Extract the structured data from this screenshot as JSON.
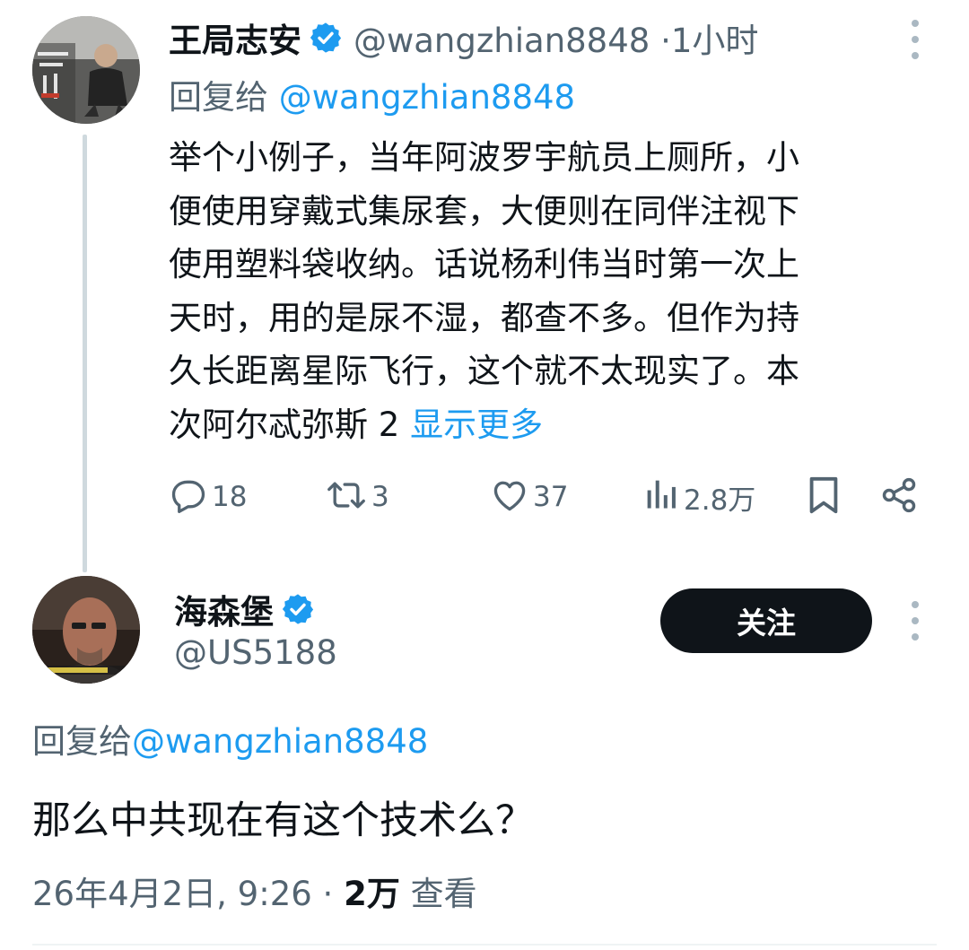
{
  "parent_tweet": {
    "display_name": "王局志安",
    "handle": "@wangzhian8848",
    "separator": "·",
    "time": "1小时",
    "reply_label": "回复给",
    "reply_mention": "@wangzhian8848",
    "body_lines": [
      "举个小例子，当年阿波罗宇航员上厕所，小",
      "便使用穿戴式集尿套，大便则在同伴注视下",
      "使用塑料袋收纳。话说杨利伟当时第一次上",
      "天时，用的是尿不湿，都查不多。但作为持",
      "久长距离星际飞行，这个就不太现实了。本"
    ],
    "body_last_line": "次阿尔忒弥斯 2 ",
    "show_more": "显示更多",
    "actions": {
      "replies": "18",
      "retweets": "3",
      "likes": "37",
      "views": "2.8万"
    }
  },
  "main_tweet": {
    "display_name": "海森堡",
    "handle": "@US5188",
    "follow_label": "关注",
    "reply_label": "回复给",
    "reply_mention": "@wangzhian8848",
    "body": "那么中共现在有这个技术么？",
    "timestamp": "26年4月2日, 9:26",
    "separator": "·",
    "views_count": "2万",
    "views_label": "查看"
  },
  "colors": {
    "text": "#0f1419",
    "secondary": "#536471",
    "link": "#1d9bf0",
    "verified": "#1d9bf0",
    "thread_line": "#cfd9de",
    "button_bg": "#0f1419"
  },
  "icons": [
    "verified-badge-icon",
    "more-options-icon",
    "reply-icon",
    "retweet-icon",
    "like-icon",
    "views-icon",
    "bookmark-icon",
    "share-icon"
  ]
}
